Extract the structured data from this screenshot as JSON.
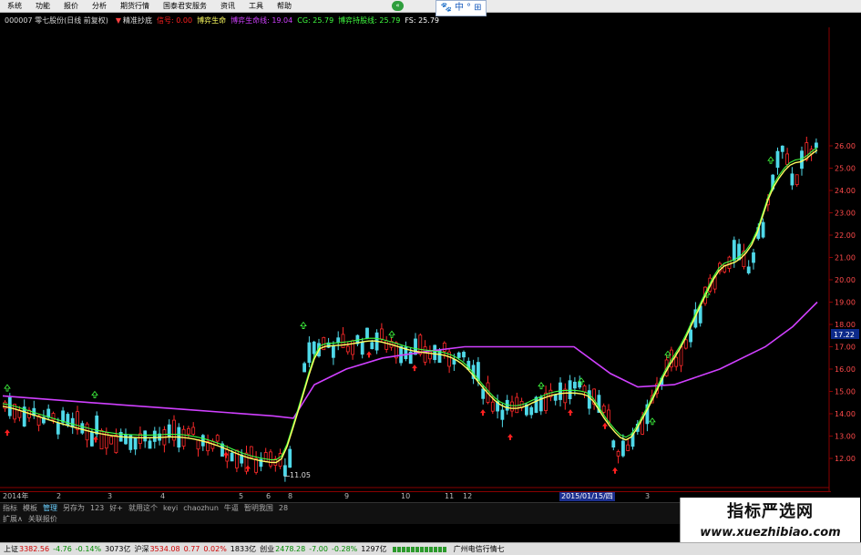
{
  "menu": {
    "items": [
      "系统",
      "功能",
      "报价",
      "分析",
      "期货行情",
      "国泰君安服务",
      "资讯",
      "工具",
      "帮助"
    ],
    "center_badge": "«",
    "ime": {
      "paw": "🐾",
      "lang": "中",
      "punct": "°",
      "grid": "⊞"
    }
  },
  "infobar": {
    "stock": "000007 零七股份(日线 前复权)",
    "indicator": "精准抄底",
    "ind_var1": "信号: 0.00",
    "ind_var2": "博弈生命",
    "ind_var3": "博弈生命线: 19.04",
    "ind_var4": "CG: 25.79",
    "ind_var5": "博弈持股线: 25.79",
    "ind_var6": "FS: 25.79",
    "colors": {
      "indicator": "#e0e0e0",
      "signal": "#ff2020",
      "life": "#ffff60",
      "lifeline": "#d040ff",
      "cg": "#40ff40",
      "hold": "#40ff40",
      "fs": "#ffffff"
    }
  },
  "chart_data": {
    "type": "candlestick",
    "period": "daily",
    "y_ticks": [
      "26.00",
      "25.00",
      "24.00",
      "23.00",
      "22.00",
      "21.00",
      "20.00",
      "19.00",
      "18.00",
      "17.00",
      "16.00",
      "15.00",
      "14.00",
      "13.00",
      "12.00"
    ],
    "ylim": [
      11.0,
      27.0
    ],
    "current_price_label": "17.22",
    "low_label": "11.05",
    "x_ticks": [
      "2014年",
      "2",
      "3",
      "4",
      "5",
      "6",
      "8",
      "9",
      "10",
      "11",
      "12",
      "2015/01/15/四",
      "3"
    ],
    "series_colors": {
      "up": "#ff2a2a",
      "down": "#4fd8e8",
      "lifeline": "#d040ff",
      "cg": "#ffff60",
      "hold": "#40ff40",
      "buy_arrow": "#ff2020",
      "sell_arrow": "#40ff40"
    }
  },
  "tabs": {
    "row1": [
      "指标",
      "模板",
      "管理",
      "另存为",
      "123",
      "好+",
      "就用这个",
      "keyi",
      "chaozhun",
      "牛逼",
      "暂明我国",
      "28"
    ],
    "row1_active": "管理",
    "row2": [
      "扩展∧",
      "关联报价"
    ]
  },
  "watermark": {
    "title": "指标严选网",
    "url": "www.xuezhibiao.com"
  },
  "status": {
    "sh_name": "上证",
    "sh_val": "3382.56",
    "sh_chg": "-4.76",
    "sh_pct": "-0.14%",
    "sh_vol": "3073亿",
    "sz_name": "沪深",
    "sz_val": "3534.08",
    "sz_chg": "0.77",
    "sz_pct": "0.02%",
    "sz_vol": "1833亿",
    "cy_name": "创业",
    "cy_val": "2478.28",
    "cy_chg": "-7.00",
    "cy_pct": "-0.28%",
    "cy_vol": "1297亿",
    "server": "广州电信行情七"
  }
}
